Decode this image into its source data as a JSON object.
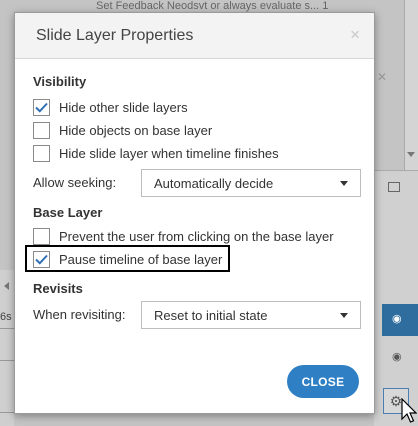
{
  "background": {
    "top_text": "Set Feedback Neodsvt or always evaluate s... 1",
    "left_label": "6s"
  },
  "dialog": {
    "title": "Slide Layer Properties",
    "close_icon": "×",
    "visibility": {
      "heading": "Visibility",
      "options": [
        {
          "label": "Hide other slide layers",
          "checked": true
        },
        {
          "label": "Hide objects on base layer",
          "checked": false
        },
        {
          "label": "Hide slide layer when timeline finishes",
          "checked": false
        }
      ],
      "seeking_label": "Allow seeking:",
      "seeking_value": "Automatically decide"
    },
    "base_layer": {
      "heading": "Base Layer",
      "options": [
        {
          "label": "Prevent the user from clicking on the base layer",
          "checked": false
        },
        {
          "label": "Pause timeline of base layer",
          "checked": true
        }
      ]
    },
    "revisits": {
      "heading": "Revisits",
      "revisiting_label": "When revisiting:",
      "revisiting_value": "Reset to initial state"
    },
    "close_button": "CLOSE"
  },
  "colors": {
    "accent": "#2f7fc4",
    "checkmark": "#2f6fb3",
    "highlight_border": "#000000"
  }
}
